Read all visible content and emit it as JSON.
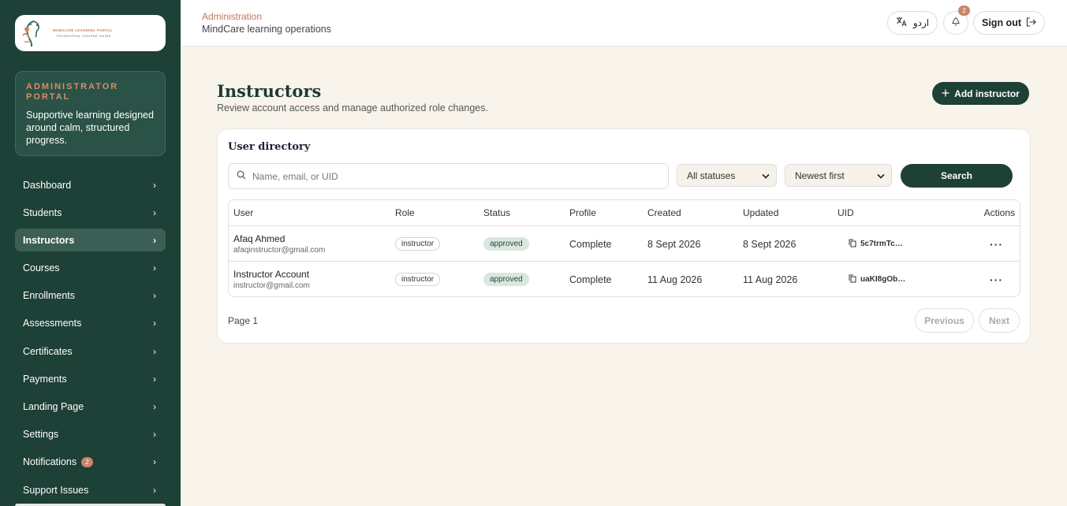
{
  "sidebar": {
    "logo": {
      "line1": "MINDCARE LEARNING PORTAL",
      "line2": "THOUGHTFUL COURSE GUIDE"
    },
    "portal_kicker": "ADMINISTRATOR PORTAL",
    "portal_desc": "Supportive learning designed around calm, structured progress.",
    "nav": [
      {
        "label": "Dashboard",
        "active": false
      },
      {
        "label": "Students",
        "active": false
      },
      {
        "label": "Instructors",
        "active": true
      },
      {
        "label": "Courses",
        "active": false
      },
      {
        "label": "Enrollments",
        "active": false
      },
      {
        "label": "Assessments",
        "active": false
      },
      {
        "label": "Certificates",
        "active": false
      },
      {
        "label": "Payments",
        "active": false
      },
      {
        "label": "Landing Page",
        "active": false
      },
      {
        "label": "Settings",
        "active": false
      },
      {
        "label": "Notifications",
        "active": false,
        "badge": "2"
      },
      {
        "label": "Support Issues",
        "active": false
      }
    ]
  },
  "topbar": {
    "kicker": "Administration",
    "subtitle": "MindCare learning operations",
    "lang_label": "اردو",
    "notification_count": "2",
    "signout_label": "Sign out"
  },
  "main": {
    "title": "Instructors",
    "subtitle": "Review account access and manage authorized role changes.",
    "add_button": "Add instructor"
  },
  "directory": {
    "title": "User directory",
    "search_placeholder": "Name, email, or UID",
    "status_filter": "All statuses",
    "sort": "Newest first",
    "search_button": "Search",
    "columns": [
      "User",
      "Role",
      "Status",
      "Profile",
      "Created",
      "Updated",
      "UID",
      "Actions"
    ],
    "rows": [
      {
        "name": "Afaq Ahmed",
        "email": "afaqinstructor@gmail.com",
        "role": "instructor",
        "status": "approved",
        "profile": "Complete",
        "created": "8 Sept 2026",
        "updated": "8 Sept 2026",
        "uid": "5c7trmTc…"
      },
      {
        "name": "Instructor Account",
        "email": "instructor@gmail.com",
        "role": "instructor",
        "status": "approved",
        "profile": "Complete",
        "created": "11 Aug 2026",
        "updated": "11 Aug 2026",
        "uid": "uaKI8gOb…"
      }
    ],
    "page_label": "Page 1",
    "prev_label": "Previous",
    "next_label": "Next"
  },
  "colors": {
    "sidebar_bg": "#1d4037",
    "accent": "#c98567",
    "primary_button": "#1d4037",
    "page_bg": "#f8f4ec"
  }
}
